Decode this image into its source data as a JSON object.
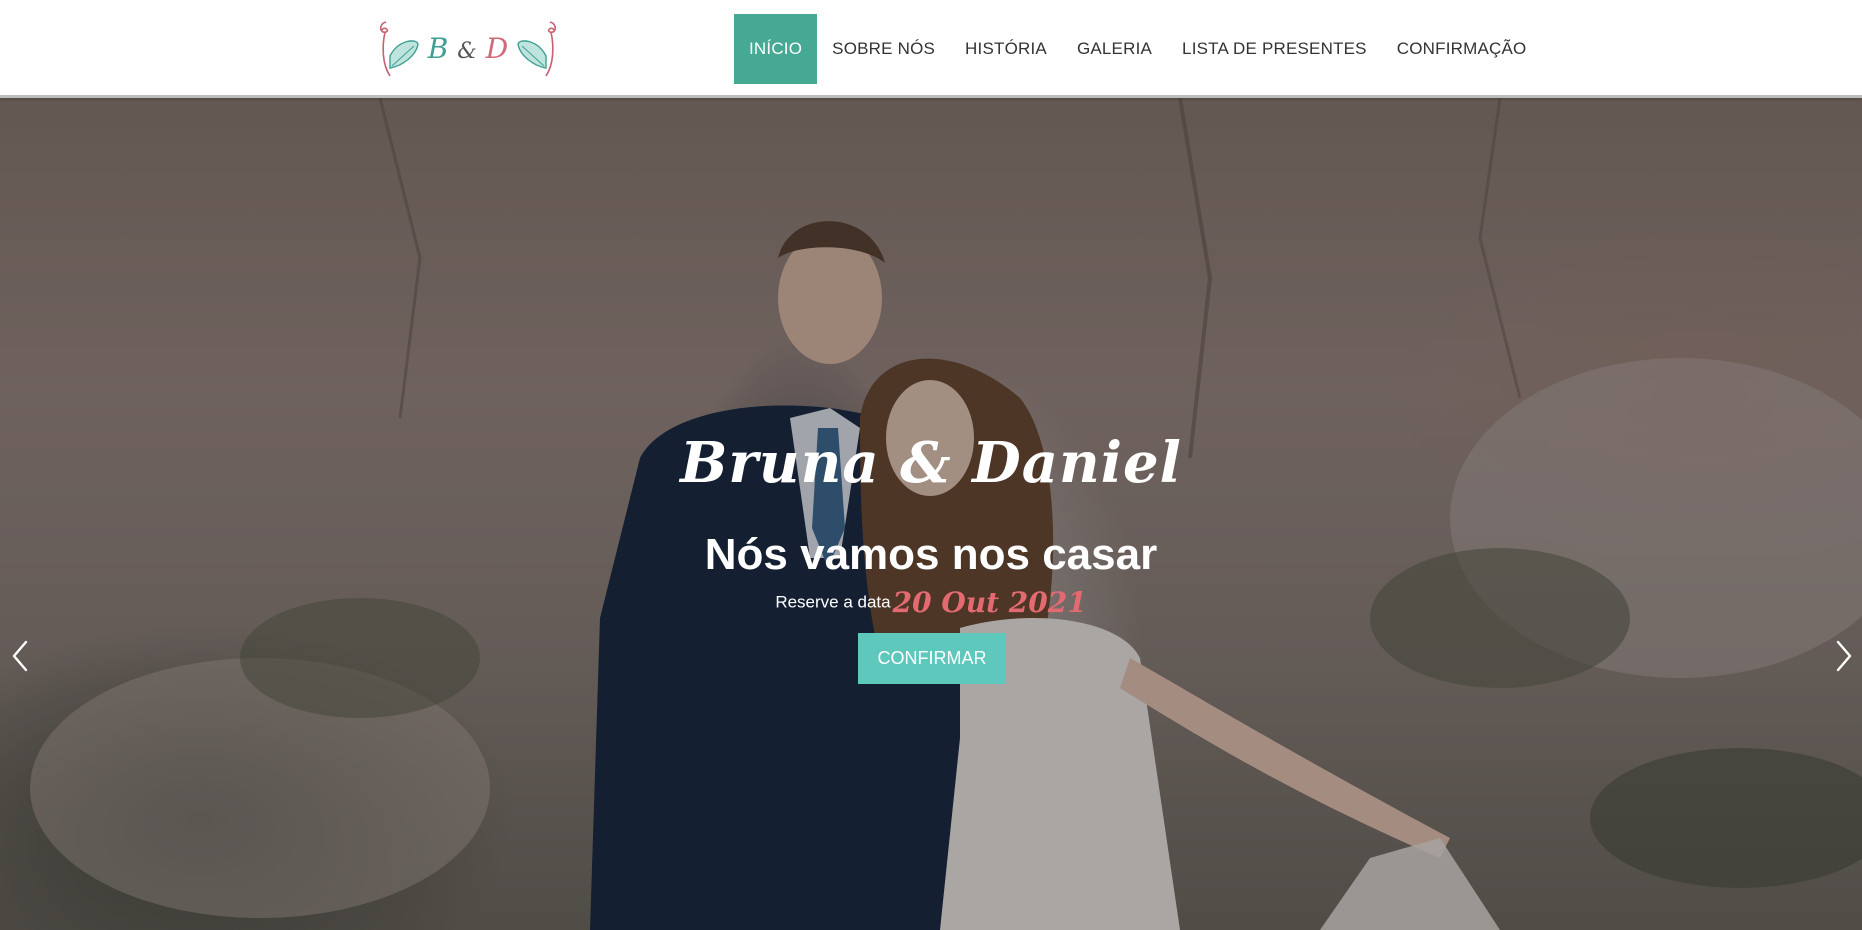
{
  "logo": {
    "first_initial": "B",
    "ampersand": "&",
    "second_initial": "D",
    "icon": "leaf-monogram-logo"
  },
  "nav": {
    "items": [
      {
        "label": "INÍCIO",
        "active": true
      },
      {
        "label": "SOBRE NÓS",
        "active": false
      },
      {
        "label": "HISTÓRIA",
        "active": false
      },
      {
        "label": "GALERIA",
        "active": false
      },
      {
        "label": "LISTA DE PRESENTES",
        "active": false
      },
      {
        "label": "CONFIRMAÇÃO",
        "active": false
      }
    ]
  },
  "hero": {
    "names": "Bruna & Daniel",
    "tagline": "Nós vamos nos casar",
    "save_date_label": "Reserve a data",
    "date": "20 Out 2021",
    "cta_label": "CONFIRMAR",
    "prev_icon": "chevron-left-icon",
    "next_icon": "chevron-right-icon"
  },
  "colors": {
    "accent": "#45a994",
    "cta": "#5ec8bd",
    "date": "#e46a72"
  }
}
